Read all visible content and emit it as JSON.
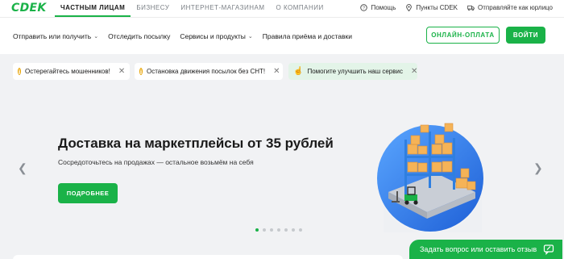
{
  "logo": {
    "text": "CDEK"
  },
  "topnav": {
    "tabs": [
      {
        "label": "ЧАСТНЫМ ЛИЦАМ",
        "active": true
      },
      {
        "label": "БИЗНЕСУ",
        "active": false
      },
      {
        "label": "ИНТЕРНЕТ-МАГАЗИНАМ",
        "active": false
      },
      {
        "label": "О КОМПАНИИ",
        "active": false
      }
    ],
    "links": [
      {
        "label": "Помощь",
        "icon": "help-icon"
      },
      {
        "label": "Пункты CDEK",
        "icon": "map-pin-icon"
      },
      {
        "label": "Отправляйте как юрлицо",
        "icon": "truck-icon"
      }
    ]
  },
  "mainnav": {
    "items": [
      {
        "label": "Отправить или получить",
        "has_dropdown": true
      },
      {
        "label": "Отследить посылку",
        "has_dropdown": false
      },
      {
        "label": "Сервисы и продукты",
        "has_dropdown": true
      },
      {
        "label": "Правила приёма и доставки",
        "has_dropdown": false
      }
    ],
    "pay_label": "ОНЛАЙН-ОПЛАТА",
    "login_label": "ВОЙТИ"
  },
  "notices": [
    {
      "text": "Остерегайтесь мошенников!",
      "icon": "warning-icon"
    },
    {
      "text": "Остановка движения посылок без СНТ!",
      "icon": "warning-icon"
    },
    {
      "text": "Помогите улучшить наш сервис",
      "icon": "hand-pointer-icon"
    }
  ],
  "hero": {
    "title": "Доставка на маркетплейсы от 35 рублей",
    "subtitle": "Сосредоточьтесь на продажах — остальное возьмём на себя",
    "button_label": "ПОДРОБНЕЕ",
    "slide_count": 7,
    "active_slide": 1
  },
  "feedback": {
    "label": "Задать вопрос или оставить отзыв"
  },
  "colors": {
    "brand": "#1ab248",
    "warning": "#e8a300",
    "background": "#f1f2f4"
  }
}
